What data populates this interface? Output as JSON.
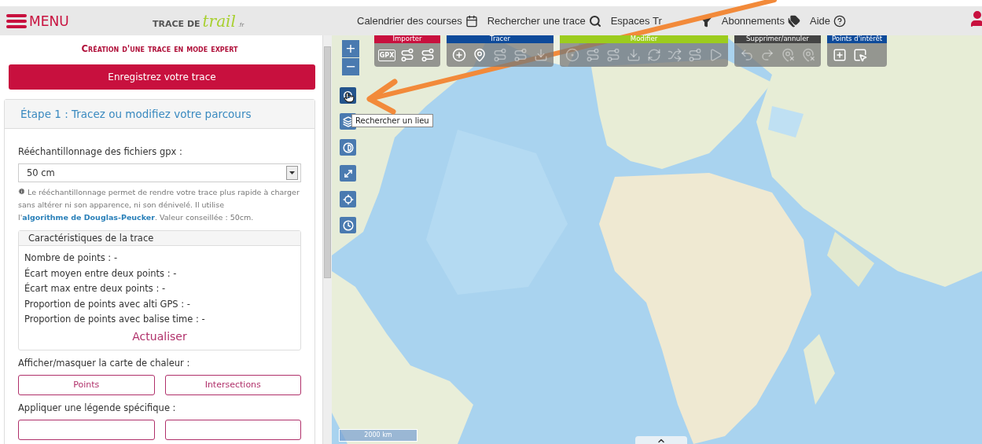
{
  "header": {
    "menu_label": "MENU",
    "logo": {
      "prefix": "TRACE DE",
      "script": "trail",
      "suffix": ".fr"
    },
    "nav": [
      {
        "label": "Calendrier des courses",
        "kind": "calendar"
      },
      {
        "label": "Rechercher une trace",
        "kind": "search"
      },
      {
        "label": "Espaces Tr",
        "kind": "funnel"
      },
      {
        "label": "Abonnements",
        "kind": "tags"
      },
      {
        "label": "Aide",
        "kind": "help"
      }
    ]
  },
  "panel": {
    "title": "Création d'une trace en mode expert",
    "save_button": "Enregistrez votre trace",
    "step_title": "Étape 1 : Tracez ou modifiez votre parcours",
    "resample": {
      "label": "Rééchantillonnage des fichiers gpx :",
      "value": "50 cm",
      "help_before": "Le rééchantillonnage permet de rendre votre trace plus rapide à charger sans altérer ni son apparence, ni son dénivelé. Il utilise l'",
      "help_link": "algorithme de Douglas-Peucker",
      "help_after": ". Valeur conseillée : 50cm."
    },
    "stats": {
      "title": "Caractéristiques de la trace",
      "lines": [
        "Nombre de points : -",
        "Écart moyen entre deux points : -",
        "Écart max entre deux points : -",
        "Proportion de points avec alti GPS : -",
        "Proportion de points avec balise time : -"
      ],
      "refresh": "Actualiser"
    },
    "heatmap": {
      "label": "Afficher/masquer la carte de chaleur :",
      "buttons": [
        "Points",
        "Intersections"
      ]
    },
    "legend": {
      "label": "Appliquer une légende spécifique :",
      "buttons": [
        {
          "kind": "outline"
        },
        {
          "kind": "outline"
        }
      ]
    }
  },
  "map": {
    "zoom_in": "+",
    "zoom_out": "−",
    "toolbar": [
      {
        "label": "Importer",
        "color": "#c8103e",
        "tools": [
          {
            "kind": "gpx",
            "text": "GPX",
            "disabled": false
          },
          {
            "kind": "route",
            "disabled": false
          },
          {
            "kind": "route",
            "disabled": false
          }
        ]
      },
      {
        "label": "Tracer",
        "color": "#0d4a9a",
        "tools": [
          {
            "kind": "plus",
            "disabled": false
          },
          {
            "kind": "pin",
            "disabled": false
          },
          {
            "kind": "route",
            "disabled": true
          },
          {
            "kind": "route",
            "disabled": true
          },
          {
            "kind": "download",
            "disabled": true
          }
        ]
      },
      {
        "label": "Modifier",
        "color": "#9ccc1e",
        "tools": [
          {
            "kind": "circle",
            "disabled": true
          },
          {
            "kind": "route",
            "disabled": true
          },
          {
            "kind": "route",
            "disabled": true
          },
          {
            "kind": "download",
            "disabled": true
          },
          {
            "kind": "refresh",
            "disabled": true
          },
          {
            "kind": "shuffle",
            "disabled": true
          },
          {
            "kind": "route",
            "disabled": true
          },
          {
            "kind": "play",
            "disabled": true
          }
        ]
      },
      {
        "label": "Supprimer/annuler",
        "color": "#444444",
        "tools": [
          {
            "kind": "undo",
            "disabled": true
          },
          {
            "kind": "redo",
            "disabled": true
          },
          {
            "kind": "pinx",
            "disabled": true
          },
          {
            "kind": "pinx",
            "disabled": true
          }
        ]
      },
      {
        "label": "Points d'intérêt",
        "color": "#0d4a9a",
        "tools": [
          {
            "kind": "squareplus",
            "disabled": false
          },
          {
            "kind": "squarecursor",
            "disabled": false
          }
        ]
      }
    ],
    "side_controls": [
      {
        "kind": "search",
        "selected": true
      },
      {
        "kind": "layers",
        "selected": false
      },
      {
        "kind": "contrast",
        "selected": false
      },
      {
        "kind": "expand",
        "selected": false
      },
      {
        "kind": "locate",
        "selected": false
      },
      {
        "kind": "clock",
        "selected": false
      }
    ],
    "tooltip": "Rechercher un lieu",
    "scale": "2000 km"
  }
}
